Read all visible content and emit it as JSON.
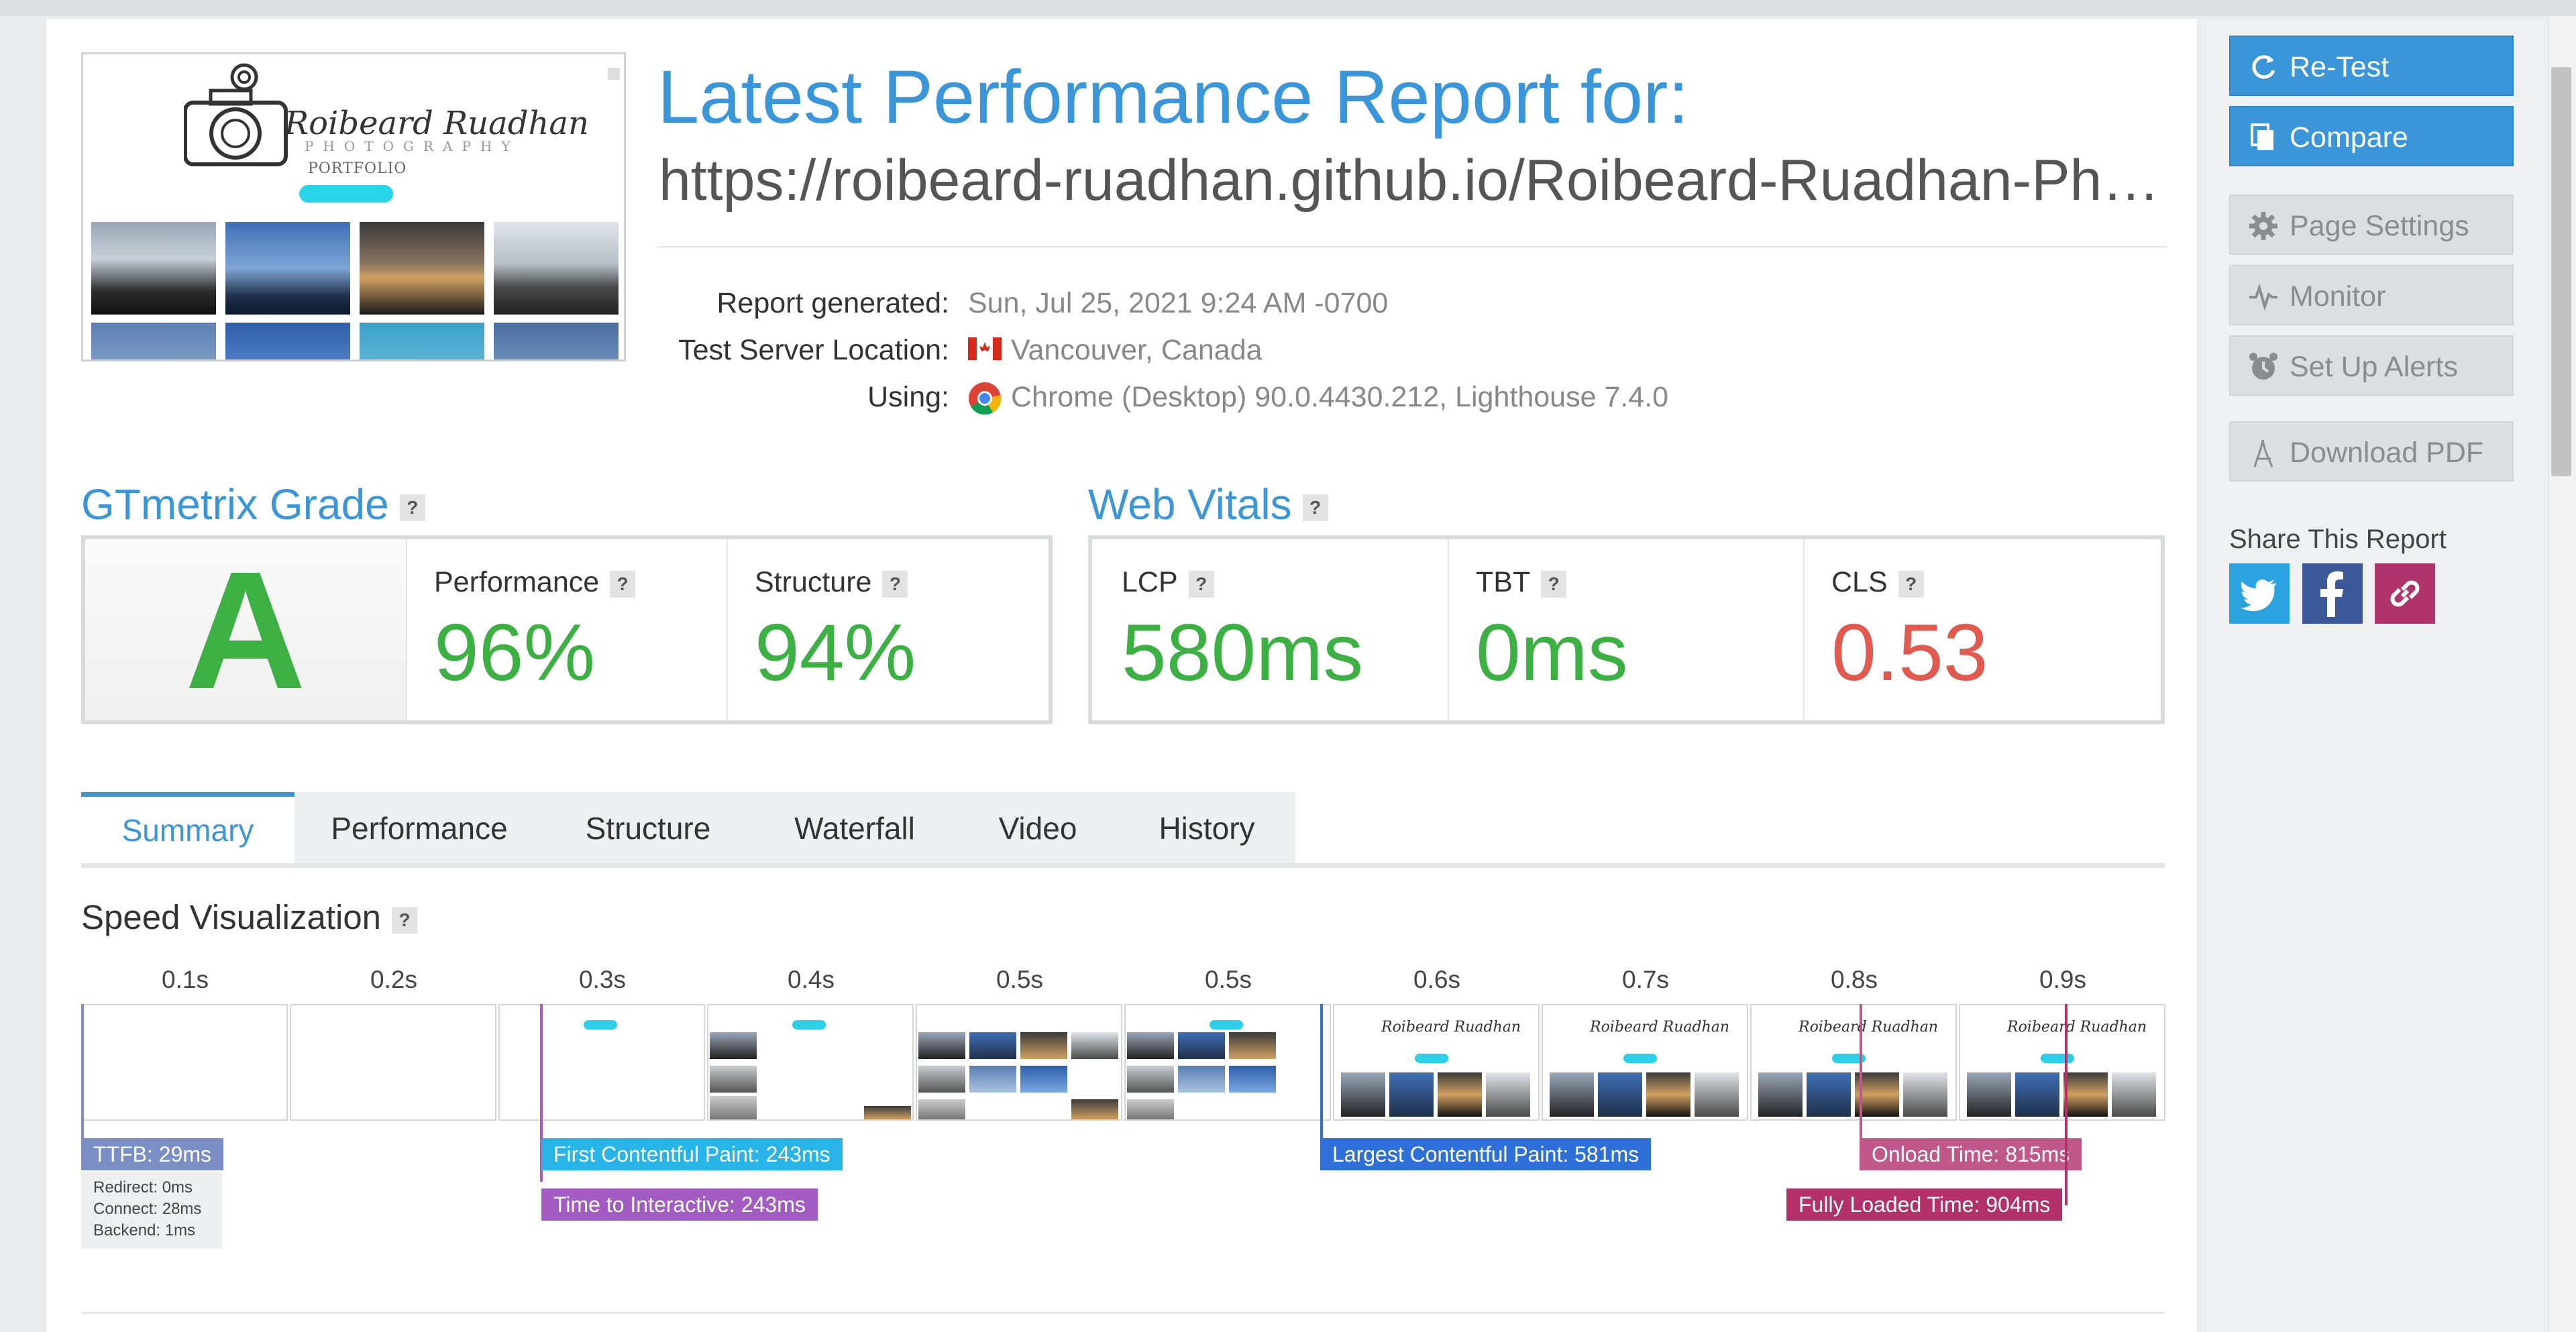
{
  "header": {
    "title": "Latest Performance Report for:",
    "url": "https://roibeard-ruadhan.github.io/Roibeard-Ruadhan-Ph…",
    "thumbnail": {
      "logo_text": "Roibeard Ruadhan",
      "logo_sub": "PHOTOGRAPHY",
      "portfolio_label": "PORTFOLIO"
    }
  },
  "meta": {
    "generated_label": "Report generated:",
    "generated_value": "Sun, Jul 25, 2021 9:24 AM -0700",
    "location_label": "Test Server Location:",
    "location_value": "Vancouver, Canada",
    "using_label": "Using:",
    "using_value": "Chrome (Desktop) 90.0.4430.212, Lighthouse 7.4.0"
  },
  "grade": {
    "title": "GTmetrix Grade",
    "help": "?",
    "letter": "A",
    "performance_label": "Performance",
    "performance_value": "96%",
    "structure_label": "Structure",
    "structure_value": "94%"
  },
  "vitals": {
    "title": "Web Vitals",
    "help": "?",
    "lcp_label": "LCP",
    "lcp_value": "580ms",
    "tbt_label": "TBT",
    "tbt_value": "0ms",
    "cls_label": "CLS",
    "cls_value": "0.53"
  },
  "tabs": [
    "Summary",
    "Performance",
    "Structure",
    "Waterfall",
    "Video",
    "History"
  ],
  "active_tab": "Summary",
  "speed": {
    "title": "Speed Visualization",
    "help": "?",
    "timestamps": [
      "0.1s",
      "0.2s",
      "0.3s",
      "0.4s",
      "0.5s",
      "0.5s",
      "0.6s",
      "0.7s",
      "0.8s",
      "0.9s"
    ],
    "ttfb": "TTFB: 29ms",
    "redirect": "Redirect: 0ms",
    "connect": "Connect: 28ms",
    "backend": "Backend: 1ms",
    "fcp": "First Contentful Paint: 243ms",
    "tti": "Time to Interactive: 243ms",
    "lcp": "Largest Contentful Paint: 581ms",
    "onload": "Onload Time: 815ms",
    "fully_loaded": "Fully Loaded Time: 904ms"
  },
  "sidebar": {
    "retest": "Re-Test",
    "compare": "Compare",
    "page_settings": "Page Settings",
    "monitor": "Monitor",
    "alerts": "Set Up Alerts",
    "download_pdf": "Download PDF",
    "share_label": "Share This Report"
  },
  "colors": {
    "accent": "#3a96d9",
    "good": "#3cb043",
    "bad": "#e05a4f",
    "ttfb": "#7b8fc4",
    "fcp": "#29b4e8",
    "tti": "#a35cc4",
    "lcp": "#2f6fd8",
    "onload": "#c0588a",
    "fully_loaded": "#b3306a",
    "twitter": "#2aa3e0",
    "facebook": "#3b5998",
    "link": "#b0346c"
  }
}
